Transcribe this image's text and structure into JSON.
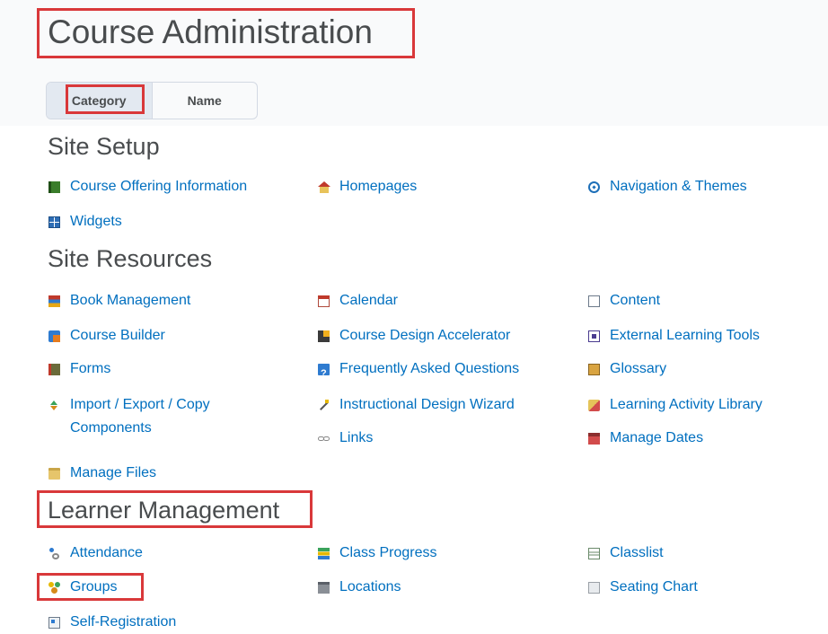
{
  "page": {
    "title": "Course Administration"
  },
  "view_toggle": {
    "options": [
      "Category",
      "Name"
    ],
    "selected": "Category"
  },
  "sections": [
    {
      "heading": "Site Setup",
      "items": [
        {
          "label": "Course Offering Information",
          "icon": "book-icon"
        },
        {
          "label": "Homepages",
          "icon": "home-icon"
        },
        {
          "label": "Navigation & Themes",
          "icon": "compass-icon"
        },
        {
          "label": "Widgets",
          "icon": "widgets-icon"
        }
      ]
    },
    {
      "heading": "Site Resources",
      "items": [
        {
          "label": "Book Management",
          "icon": "books-icon"
        },
        {
          "label": "Calendar",
          "icon": "calendar-icon"
        },
        {
          "label": "Content",
          "icon": "content-book-icon"
        },
        {
          "label": "Course Builder",
          "icon": "course-builder-icon"
        },
        {
          "label": "Course Design Accelerator",
          "icon": "accelerator-icon"
        },
        {
          "label": "External Learning Tools",
          "icon": "external-tools-icon"
        },
        {
          "label": "Forms",
          "icon": "forms-icon"
        },
        {
          "label": "Frequently Asked Questions",
          "icon": "faq-icon"
        },
        {
          "label": "Glossary",
          "icon": "glossary-icon"
        },
        {
          "label": "Import / Export / Copy Components",
          "icon": "import-export-icon"
        },
        {
          "label": "Instructional Design Wizard",
          "icon": "wand-icon"
        },
        {
          "label": "Learning Activity Library",
          "icon": "activity-library-icon"
        },
        {
          "label": "Links",
          "icon": "link-icon"
        },
        {
          "label": "Manage Dates",
          "icon": "manage-dates-icon"
        },
        {
          "label": "Manage Files",
          "icon": "folder-icon"
        }
      ]
    },
    {
      "heading": "Learner Management",
      "items": [
        {
          "label": "Attendance",
          "icon": "attendance-icon"
        },
        {
          "label": "Class Progress",
          "icon": "class-progress-icon"
        },
        {
          "label": "Classlist",
          "icon": "classlist-icon"
        },
        {
          "label": "Groups",
          "icon": "groups-icon"
        },
        {
          "label": "Locations",
          "icon": "locations-icon"
        },
        {
          "label": "Seating Chart",
          "icon": "seating-chart-icon"
        },
        {
          "label": "Self-Registration",
          "icon": "self-registration-icon"
        }
      ]
    }
  ],
  "colors": {
    "link": "#006fbf",
    "heading": "#494c4e",
    "highlight_box": "#d9383a",
    "toggle_active_bg": "#e3e9f1"
  }
}
